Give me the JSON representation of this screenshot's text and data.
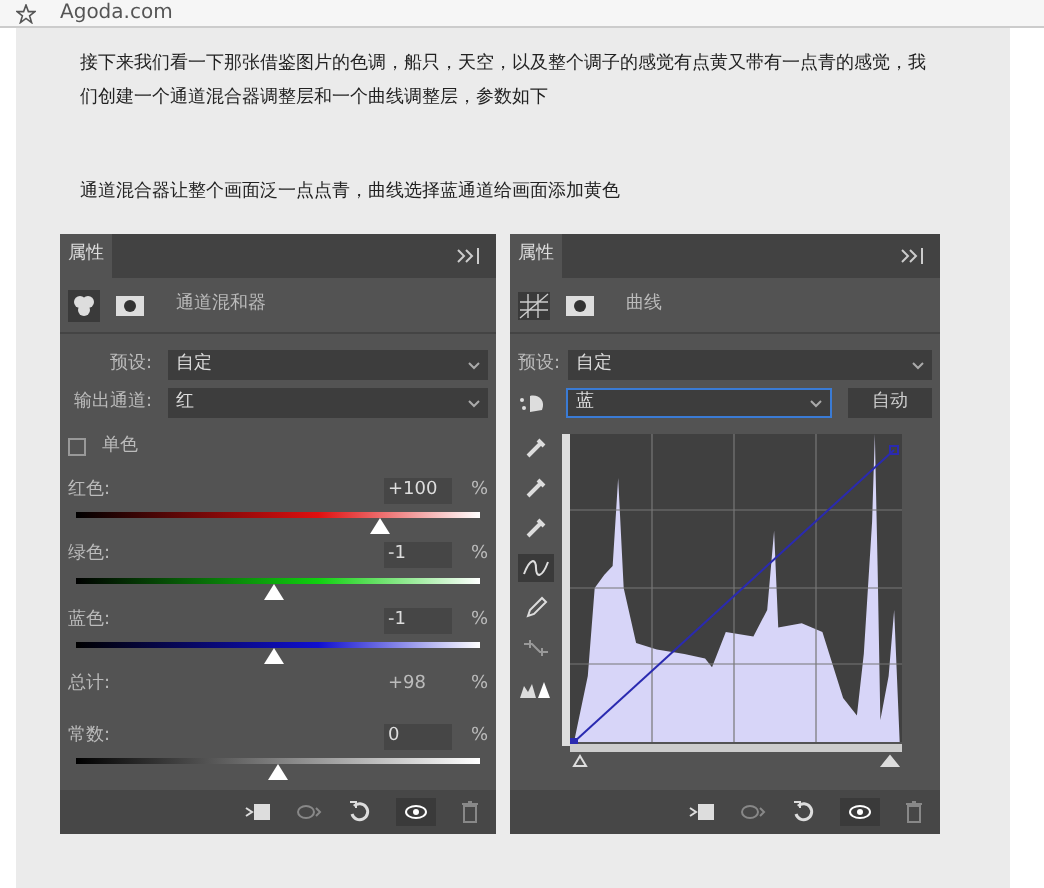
{
  "bookmark_bar": {
    "label": "Agoda.com"
  },
  "paragraphs": [
    "接下来我们看一下那张借鉴图片的色调，船只，天空，以及整个调子的感觉有点黄又带有一点青的感觉，我们创建一个通道混合器调整层和一个曲线调整层，参数如下",
    "通道混合器让整个画面泛一点点青，曲线选择蓝通道给画面添加黄色"
  ],
  "mixer_panel": {
    "tab": "属性",
    "title": "通道混和器",
    "preset_label": "预设:",
    "preset_value": "自定",
    "output_label": "输出通道:",
    "output_value": "红",
    "monochrome": {
      "label": "单色",
      "checked": false
    },
    "sliders": [
      {
        "kind": "red",
        "label": "红色:",
        "value": "+100",
        "unit": "%",
        "level": 0.75
      },
      {
        "kind": "green",
        "label": "绿色:",
        "value": "-1",
        "unit": "%",
        "level": 0.49
      },
      {
        "kind": "blue",
        "label": "蓝色:",
        "value": "-1",
        "unit": "%",
        "level": 0.49
      }
    ],
    "total": {
      "label": "总计:",
      "value": "+98",
      "unit": "%"
    },
    "constant": {
      "label": "常数:",
      "value": "0",
      "unit": "%",
      "level": 0.5
    }
  },
  "curves_panel": {
    "tab": "属性",
    "title": "曲线",
    "preset_label": "预设:",
    "preset_value": "自定",
    "channel_value": "蓝",
    "auto_button": "自动",
    "tools": [
      {
        "kind": "eyedropper",
        "selected": false
      },
      {
        "kind": "eyedropper",
        "selected": false
      },
      {
        "kind": "eyedropper",
        "selected": false
      },
      {
        "kind": "curve",
        "selected": true
      },
      {
        "kind": "pencil",
        "selected": false
      },
      {
        "kind": "smooth",
        "selected": false
      },
      {
        "kind": "clipping",
        "selected": false
      }
    ]
  }
}
